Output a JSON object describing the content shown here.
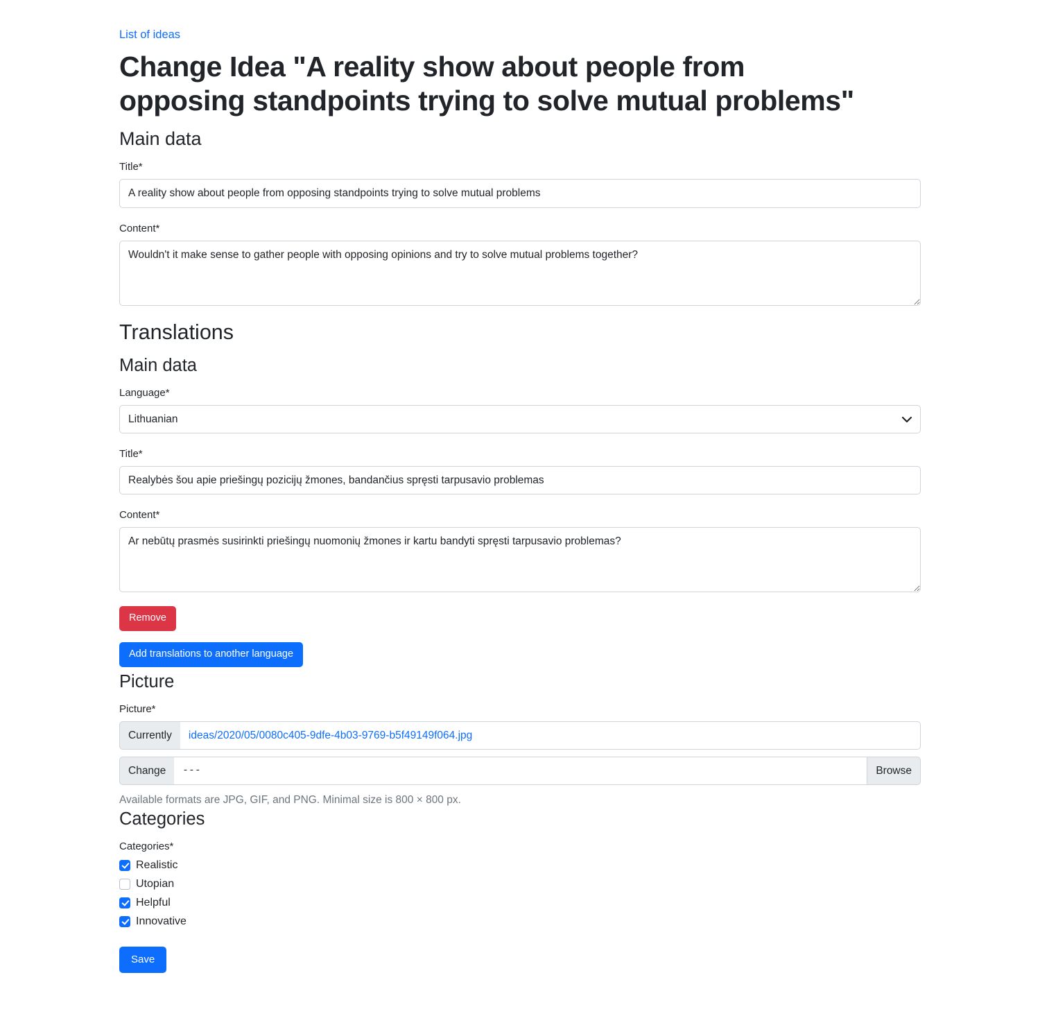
{
  "breadcrumb": {
    "label": "List of ideas"
  },
  "page": {
    "title": "Change Idea \"A reality show about people from opposing standpoints trying to solve mutual problems\""
  },
  "main_data": {
    "heading": "Main data",
    "title_label": "Title*",
    "title_value": "A reality show about people from opposing standpoints trying to solve mutual problems",
    "content_label": "Content*",
    "content_value": "Wouldn't it make sense to gather people with opposing opinions and try to solve mutual problems together?"
  },
  "translations": {
    "heading": "Translations",
    "sub_heading": "Main data",
    "language_label": "Language*",
    "language_value": "Lithuanian",
    "language_options": [
      "Lithuanian"
    ],
    "title_label": "Title*",
    "title_value": "Realybės šou apie priešingų pozicijų žmones, bandančius spręsti tarpusavio problemas",
    "content_label": "Content*",
    "content_value": "Ar nebūtų prasmės susirinkti priešingų nuomonių žmones ir kartu bandyti spręsti tarpusavio problemas?",
    "remove_label": "Remove",
    "add_label": "Add translations to another language"
  },
  "picture": {
    "heading": "Picture",
    "field_label": "Picture*",
    "currently_label": "Currently",
    "currently_file": "ideas/2020/05/0080c405-9dfe-4b03-9769-b5f49149f064.jpg",
    "change_label": "Change",
    "change_value": "---",
    "browse_label": "Browse",
    "help_text": "Available formats are JPG, GIF, and PNG. Minimal size is 800 × 800 px."
  },
  "categories": {
    "heading": "Categories",
    "field_label": "Categories*",
    "items": [
      {
        "label": "Realistic",
        "checked": true
      },
      {
        "label": "Utopian",
        "checked": false
      },
      {
        "label": "Helpful",
        "checked": true
      },
      {
        "label": "Innovative",
        "checked": true
      }
    ]
  },
  "actions": {
    "save_label": "Save"
  },
  "colors": {
    "link": "#0d6efd",
    "primary": "#0d6efd",
    "danger": "#dc3545",
    "muted": "#6c757d",
    "border": "#ced4da",
    "addon_bg": "#e9ecef"
  }
}
